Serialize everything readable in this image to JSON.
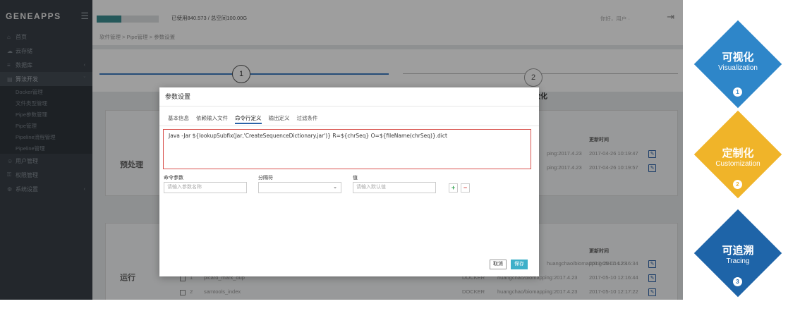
{
  "app": {
    "logo": "GENEAPPS",
    "menu_icon": "hamburger-icon"
  },
  "topbar": {
    "quota_text": "已使用840.573 / 总空间100.00G",
    "quota_fraction": 0.4,
    "user": "你好，用户 ·"
  },
  "breadcrumb": "软件管理 > Pipe管理 > 参数设置",
  "sidebar": {
    "items": [
      {
        "label": "首页",
        "icon": "home-icon"
      },
      {
        "label": "云存储",
        "icon": "cloud-icon"
      },
      {
        "label": "数据库",
        "icon": "database-icon",
        "arrow": "‹"
      },
      {
        "label": "算法开发",
        "icon": "code-icon",
        "arrow": "ˇ"
      }
    ],
    "subitems": [
      "Docker管理",
      "文件类型管理",
      "Pipe参数管理",
      "Pipe管理",
      "Pipeline流程管理",
      "Pipeline管理"
    ],
    "items2": [
      {
        "label": "用户管理",
        "icon": "user-icon"
      },
      {
        "label": "权限管理",
        "icon": "lock-icon"
      },
      {
        "label": "系统设置",
        "icon": "gear-icon",
        "arrow": "‹"
      }
    ]
  },
  "steps": {
    "one": "1",
    "two": "2",
    "step2_title": "数化"
  },
  "panels": {
    "preprocess": {
      "label": "预处理",
      "col_header": "更新时间",
      "rows": [
        {
          "c1": "ping:2017.4.23",
          "c2": "2017-04-26 10:19:47"
        },
        {
          "c1": "ping:2017.4.23",
          "c2": "2017-04-26 10:19:57"
        }
      ]
    },
    "run": {
      "label": "运行",
      "col_header": "更新时间",
      "rows": [
        {
          "no": "1",
          "name": "picard_mark_dup",
          "type": "DOCKER",
          "c1": "huangchao/biomapping:2017.4.23",
          "c2": "2017-05-10 12:16:34"
        },
        {
          "no": "2",
          "name": "samtools_index",
          "type": "DOCKER",
          "c1": "huangchao/biomapping:2017.4.23",
          "c2": "2017-05-10 12:16:44"
        },
        {
          "no": "2",
          "name": "samtools_index",
          "type": "DOCKER",
          "c1": "huangchao/biomapping:2017.4.23",
          "c2": "2017-05-10 12:17:22"
        }
      ]
    }
  },
  "modal": {
    "title": "参数设置",
    "tabs": [
      "基本信息",
      "依赖输入文件",
      "命令行定义",
      "输出定义",
      "过滤条件"
    ],
    "command": "Java -Jar ${lookupSubfix(Jar,'CreateSequenceDictionary.jar')}  R=${chrSeq} O=${fileName(chrSeq)}.dict",
    "fields": {
      "param_label": "命令参数",
      "param_placeholder": "请输入参数名称",
      "sep_label": "分隔符",
      "value_label": "值",
      "value_placeholder": "请输入默认值"
    },
    "plus": "+",
    "minus": "−",
    "cancel": "取消",
    "save": "保存"
  },
  "features": [
    {
      "zh": "可视化",
      "en": "Visualization",
      "num": "1",
      "color": "#2e86c9"
    },
    {
      "zh": "定制化",
      "en": "Customization",
      "num": "2",
      "color": "#f0b429"
    },
    {
      "zh": "可追溯",
      "en": "Tracing",
      "num": "3",
      "color": "#1e64a8"
    }
  ]
}
